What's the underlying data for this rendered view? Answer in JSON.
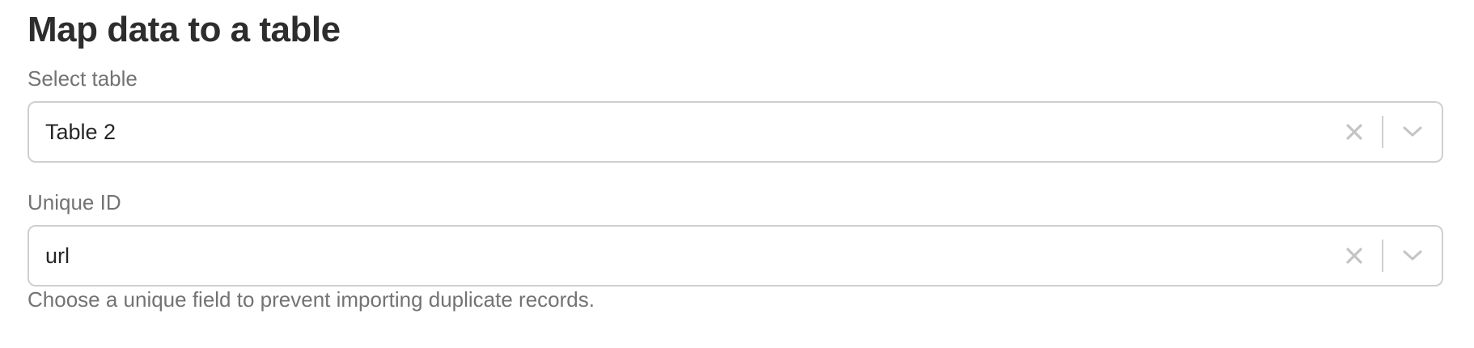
{
  "header": {
    "title": "Map data to a table"
  },
  "table_field": {
    "label": "Select table",
    "value": "Table 2",
    "clear_icon": "close-icon",
    "dropdown_icon": "chevron-down-icon"
  },
  "unique_id_field": {
    "label": "Unique ID",
    "value": "url",
    "clear_icon": "close-icon",
    "dropdown_icon": "chevron-down-icon",
    "hint": "Choose a unique field to prevent importing duplicate records."
  },
  "colors": {
    "title": "#2d2d2d",
    "label": "#737373",
    "border": "#cfcfcf",
    "icon": "#c4c4c4"
  }
}
